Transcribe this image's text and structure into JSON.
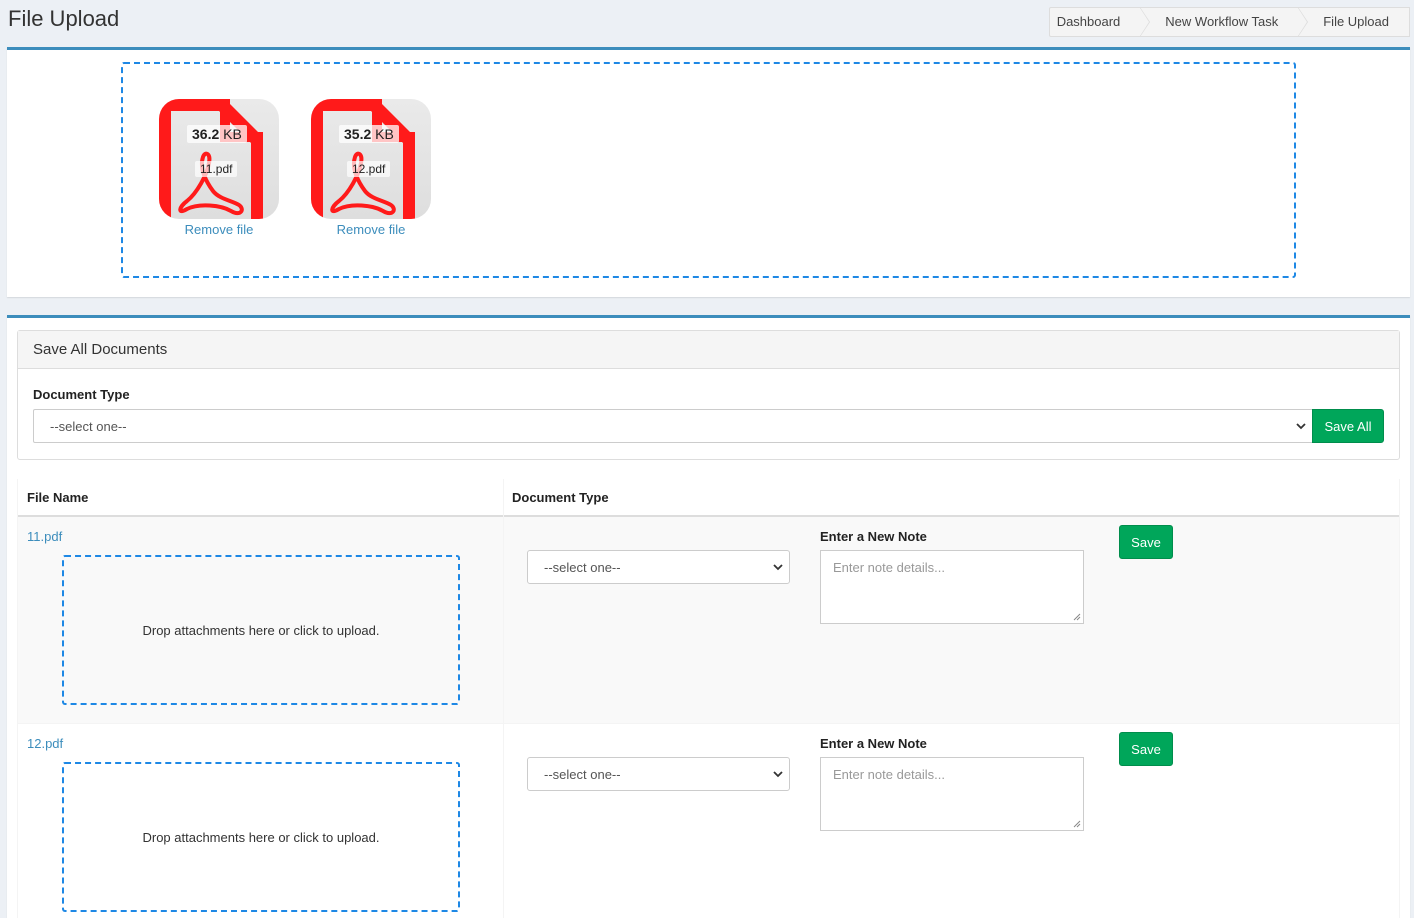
{
  "page": {
    "title": "File Upload"
  },
  "breadcrumb": [
    {
      "label": "Dashboard"
    },
    {
      "label": "New Workflow Task"
    },
    {
      "label": "File Upload"
    }
  ],
  "upload_previews": [
    {
      "size_value": "36.2",
      "size_unit": "KB",
      "name": "11.pdf",
      "remove_label": "Remove file"
    },
    {
      "size_value": "35.2",
      "size_unit": "KB",
      "name": "12.pdf",
      "remove_label": "Remove file"
    }
  ],
  "save_all_panel": {
    "heading": "Save All Documents",
    "doc_type_label": "Document Type",
    "select_value": "--select one--",
    "save_all_label": "Save All"
  },
  "table": {
    "headers": {
      "file_name": "File Name",
      "document_type": "Document Type"
    },
    "rows": [
      {
        "file_name": "11.pdf",
        "drop_text": "Drop attachments here or click to upload.",
        "select_value": "--select one--",
        "note_label": "Enter a New Note",
        "note_placeholder": "Enter note details...",
        "save_label": "Save"
      },
      {
        "file_name": "12.pdf",
        "drop_text": "Drop attachments here or click to upload.",
        "select_value": "--select one--",
        "note_label": "Enter a New Note",
        "note_placeholder": "Enter note details...",
        "save_label": "Save"
      }
    ]
  },
  "icons": {
    "pdf": "pdf-file-icon",
    "chevron": "chevron-down-icon",
    "resize": "resize-grip-icon"
  },
  "colors": {
    "accent_blue": "#3c8dbc",
    "dropzone_border": "#1e88e5",
    "success_green": "#00a65a",
    "pdf_red": "#ff1a1a"
  }
}
